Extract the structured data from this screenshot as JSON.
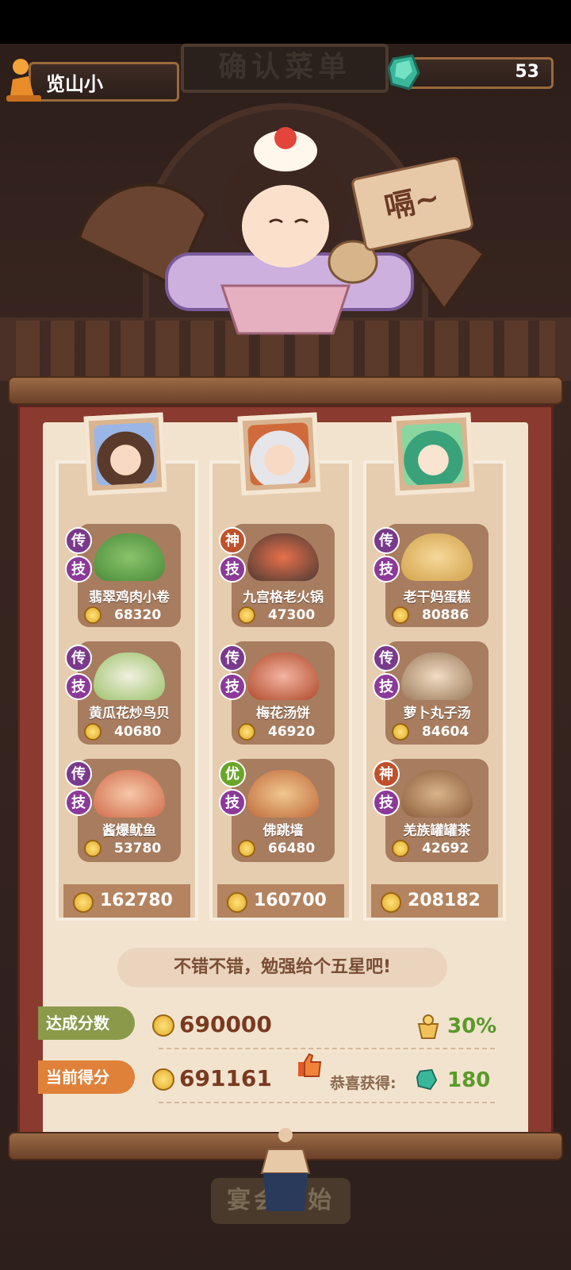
{
  "header": {
    "title": "确认菜单"
  },
  "player": {
    "name": "览山小"
  },
  "gems": {
    "count": "53"
  },
  "speech": "嗝~",
  "columns": [
    {
      "dishes": [
        {
          "badge_top": "传",
          "badge_bottom": "技",
          "name": "翡翠鸡肉小卷",
          "score": "68320"
        },
        {
          "badge_top": "传",
          "badge_bottom": "技",
          "name": "黄瓜花炒鸟贝",
          "score": "40680"
        },
        {
          "badge_top": "传",
          "badge_bottom": "技",
          "name": "酱爆鱿鱼",
          "score": "53780"
        }
      ],
      "total": "162780"
    },
    {
      "dishes": [
        {
          "badge_top": "神",
          "badge_bottom": "技",
          "name": "九宫格老火锅",
          "score": "47300"
        },
        {
          "badge_top": "传",
          "badge_bottom": "技",
          "name": "梅花汤饼",
          "score": "46920"
        },
        {
          "badge_top": "优",
          "badge_bottom": "技",
          "name": "佛跳墙",
          "score": "66480"
        }
      ],
      "total": "160700"
    },
    {
      "dishes": [
        {
          "badge_top": "传",
          "badge_bottom": "技",
          "name": "老干妈蛋糕",
          "score": "80886"
        },
        {
          "badge_top": "传",
          "badge_bottom": "技",
          "name": "萝卜丸子汤",
          "score": "84604"
        },
        {
          "badge_top": "神",
          "badge_bottom": "技",
          "name": "羌族罐罐茶",
          "score": "42692"
        }
      ],
      "total": "208182"
    }
  ],
  "comment": "不错不错，勉强给个五星吧!",
  "target": {
    "label": "达成分数",
    "value": "690000",
    "bonus": "30%"
  },
  "current": {
    "label": "当前得分",
    "value": "691161",
    "reward_label": "恭喜获得:",
    "reward_value": "180"
  },
  "start_button": "宴会开始",
  "colors": {
    "badge_chuan": "#7a3a8c",
    "badge_shen": "#c0502a",
    "badge_you": "#6aa52a",
    "badge_ji": "#8c3a9a",
    "accent_green": "#5a9a2a"
  }
}
